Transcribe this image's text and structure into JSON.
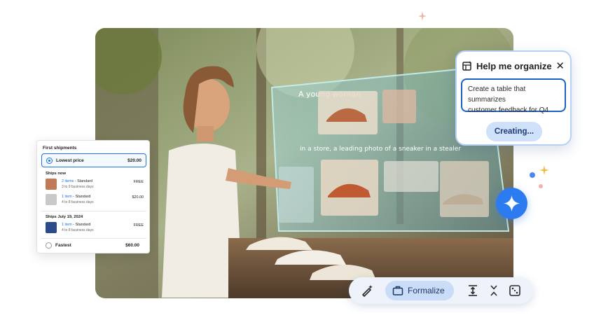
{
  "organize_card": {
    "title": "Help me organize",
    "close_icon": "close-icon",
    "prompt_line1": "Create a table that summarizes",
    "prompt_line2": "customer feedback for Q4",
    "status_button": "Creating..."
  },
  "shipping": {
    "title": "First shipments",
    "lowest_label": "Lowest price",
    "lowest_price": "$20.00",
    "ships_now_heading": "Ships now",
    "items": [
      {
        "link": "2 items",
        "method": " - Standard",
        "days": "3 to 9 business days",
        "fee": "FREE"
      },
      {
        "link": "1 item",
        "method": " - Standard",
        "days": "4 to 8 business days",
        "fee": "$20.00"
      },
      {
        "link": "1 item",
        "method": " - Standard",
        "days": "4 to 8 business days",
        "fee": "FREE"
      }
    ],
    "ships_later_heading": "Ships July 19, 2024",
    "fastest_label": "Fastest",
    "fastest_price": "$60.00"
  },
  "toolbar": {
    "formalize_label": "Formalize",
    "icons": [
      "magic-pen-icon",
      "briefcase-icon",
      "expand-text-icon",
      "shorten-icon",
      "dice-icon"
    ]
  },
  "hero": {
    "screen_heading": "A young woman",
    "screen_caption": "in a store, a leading photo of a sneaker in a stealer"
  },
  "colors": {
    "accent_blue": "#1a73e8",
    "gemini_blue": "#2d7bf0",
    "card_border": "#b7d0f7",
    "toolbar_bg": "#eef3fb",
    "formalize_bg": "#c9dcf8"
  }
}
